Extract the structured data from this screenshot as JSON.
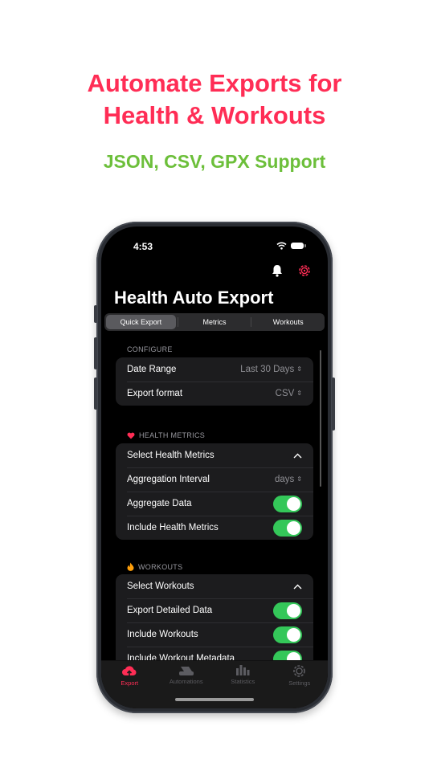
{
  "promo": {
    "headline_line1": "Automate Exports for",
    "headline_line2": "Health & Workouts",
    "subheadline": "JSON, CSV, GPX Support"
  },
  "status_bar": {
    "time": "4:53"
  },
  "app": {
    "title": "Health Auto Export",
    "segments": [
      "Quick Export",
      "Metrics",
      "Workouts"
    ],
    "active_segment": "Quick Export"
  },
  "configure": {
    "header": "CONFIGURE",
    "date_range_label": "Date Range",
    "date_range_value": "Last 30 Days",
    "export_format_label": "Export format",
    "export_format_value": "CSV"
  },
  "health_metrics": {
    "header": "HEALTH METRICS",
    "select_label": "Select Health Metrics",
    "aggregation_label": "Aggregation Interval",
    "aggregation_value": "days",
    "aggregate_label": "Aggregate Data",
    "aggregate_on": true,
    "include_label": "Include Health Metrics",
    "include_on": true
  },
  "workouts": {
    "header": "WORKOUTS",
    "select_label": "Select Workouts",
    "detailed_label": "Export Detailed Data",
    "detailed_on": true,
    "include_label": "Include Workouts",
    "include_on": true,
    "metadata_label": "Include Workout Metadata",
    "metadata_on": true
  },
  "tabbar": {
    "items": [
      "Export",
      "Automations",
      "Statistics",
      "Settings"
    ],
    "active": "Export"
  },
  "colors": {
    "accent_pink": "#ff2d55",
    "accent_green": "#6cbf3a",
    "toggle_green": "#34c759"
  }
}
